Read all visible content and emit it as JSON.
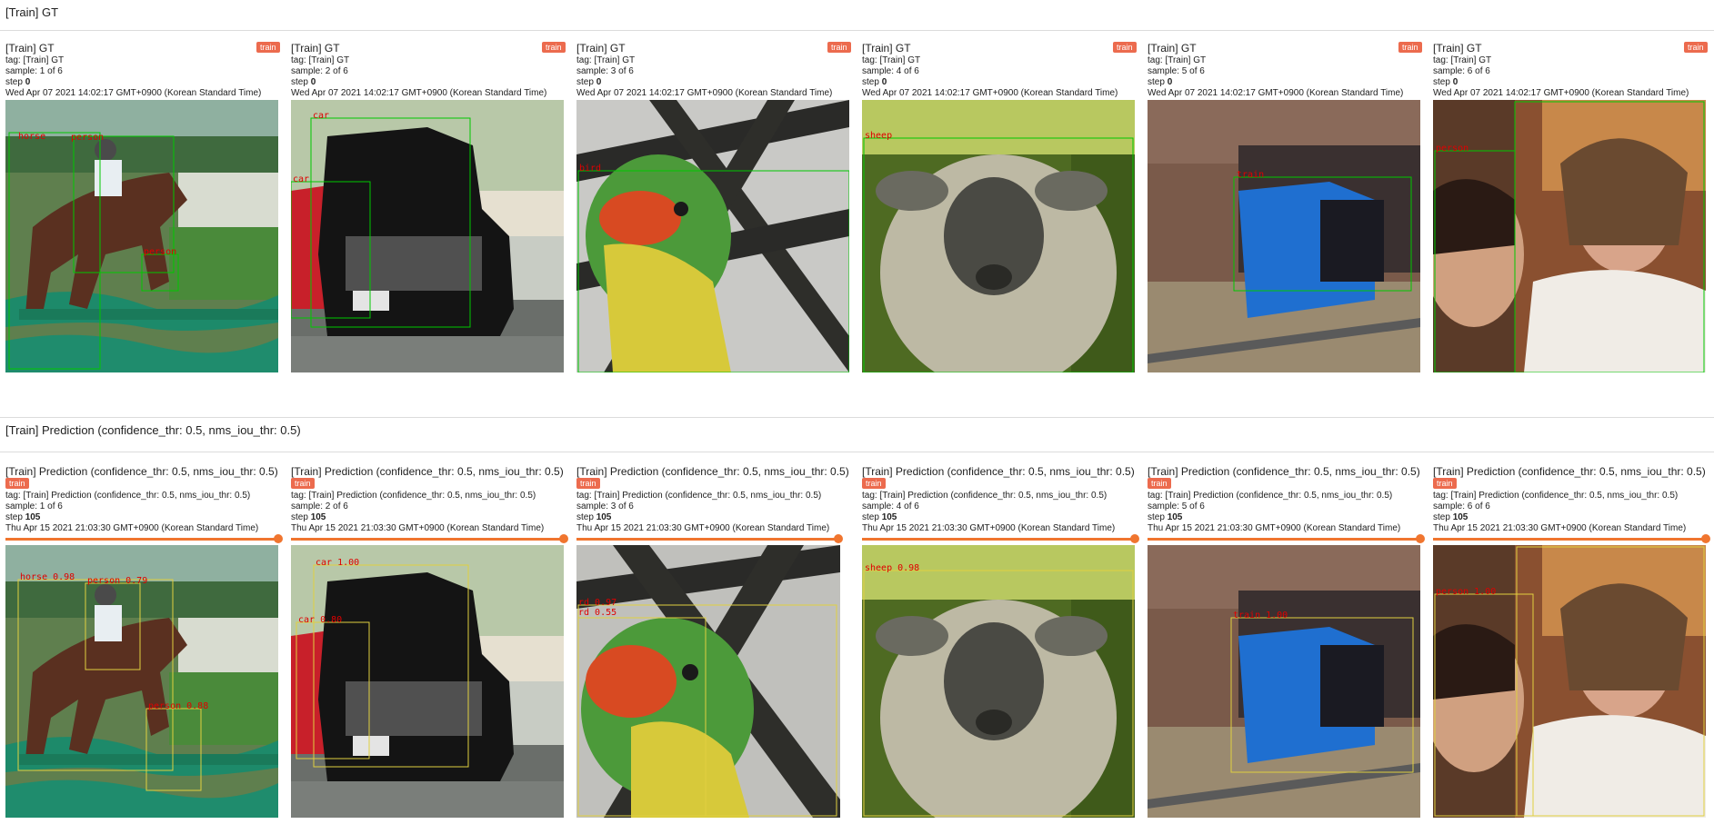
{
  "sections": {
    "gt": {
      "title": "[Train] GT",
      "cards": [
        {
          "title": "[Train] GT",
          "badge": "train",
          "tag": "tag: [Train] GT",
          "sample": "sample: 1 of 6",
          "step_label": "step ",
          "step": "0",
          "timestamp": "Wed Apr 07 2021 14:02:17 GMT+0900 (Korean Standard Time)",
          "labels": [
            "horse",
            "person",
            "person"
          ]
        },
        {
          "title": "[Train] GT",
          "badge": "train",
          "tag": "tag: [Train] GT",
          "sample": "sample: 2 of 6",
          "step_label": "step ",
          "step": "0",
          "timestamp": "Wed Apr 07 2021 14:02:17 GMT+0900 (Korean Standard Time)",
          "labels": [
            "car",
            "car"
          ]
        },
        {
          "title": "[Train] GT",
          "badge": "train",
          "tag": "tag: [Train] GT",
          "sample": "sample: 3 of 6",
          "step_label": "step ",
          "step": "0",
          "timestamp": "Wed Apr 07 2021 14:02:17 GMT+0900 (Korean Standard Time)",
          "labels": [
            "bird"
          ]
        },
        {
          "title": "[Train] GT",
          "badge": "train",
          "tag": "tag: [Train] GT",
          "sample": "sample: 4 of 6",
          "step_label": "step ",
          "step": "0",
          "timestamp": "Wed Apr 07 2021 14:02:17 GMT+0900 (Korean Standard Time)",
          "labels": [
            "sheep"
          ]
        },
        {
          "title": "[Train] GT",
          "badge": "train",
          "tag": "tag: [Train] GT",
          "sample": "sample: 5 of 6",
          "step_label": "step ",
          "step": "0",
          "timestamp": "Wed Apr 07 2021 14:02:17 GMT+0900 (Korean Standard Time)",
          "labels": [
            "train"
          ]
        },
        {
          "title": "[Train] GT",
          "badge": "train",
          "tag": "tag: [Train] GT",
          "sample": "sample: 6 of 6",
          "step_label": "step ",
          "step": "0",
          "timestamp": "Wed Apr 07 2021 14:02:17 GMT+0900 (Korean Standard Time)",
          "labels": [
            "person"
          ]
        }
      ]
    },
    "pred": {
      "title": "[Train] Prediction (confidence_thr: 0.5, nms_iou_thr: 0.5)",
      "cards": [
        {
          "title": "[Train] Prediction (confidence_thr: 0.5, nms_iou_thr: 0.5)",
          "badge": "train",
          "tag": "tag: [Train] Prediction (confidence_thr: 0.5, nms_iou_thr: 0.5)",
          "sample": "sample: 1 of 6",
          "step_label": "step ",
          "step": "105",
          "timestamp": "Thu Apr 15 2021 21:03:30 GMT+0900 (Korean Standard Time)",
          "slider": 1.0,
          "labels": [
            "horse 0.98",
            "person 0.79",
            "person 0.88"
          ]
        },
        {
          "title": "[Train] Prediction (confidence_thr: 0.5, nms_iou_thr: 0.5)",
          "badge": "train",
          "tag": "tag: [Train] Prediction (confidence_thr: 0.5, nms_iou_thr: 0.5)",
          "sample": "sample: 2 of 6",
          "step_label": "step ",
          "step": "105",
          "timestamp": "Thu Apr 15 2021 21:03:30 GMT+0900 (Korean Standard Time)",
          "slider": 1.0,
          "labels": [
            "car 1.00",
            "car 0.80"
          ]
        },
        {
          "title": "[Train] Prediction (confidence_thr: 0.5, nms_iou_thr: 0.5)",
          "badge": "train",
          "tag": "tag: [Train] Prediction (confidence_thr: 0.5, nms_iou_thr: 0.5)",
          "sample": "sample: 3 of 6",
          "step_label": "step ",
          "step": "105",
          "timestamp": "Thu Apr 15 2021 21:03:30 GMT+0900 (Korean Standard Time)",
          "slider": 1.0,
          "labels": [
            "rd 0.97",
            "rd 0.55"
          ]
        },
        {
          "title": "[Train] Prediction (confidence_thr: 0.5, nms_iou_thr: 0.5)",
          "badge": "train",
          "tag": "tag: [Train] Prediction (confidence_thr: 0.5, nms_iou_thr: 0.5)",
          "sample": "sample: 4 of 6",
          "step_label": "step ",
          "step": "105",
          "timestamp": "Thu Apr 15 2021 21:03:30 GMT+0900 (Korean Standard Time)",
          "slider": 1.0,
          "labels": [
            "sheep 0.98"
          ]
        },
        {
          "title": "[Train] Prediction (confidence_thr: 0.5, nms_iou_thr: 0.5)",
          "badge": "train",
          "tag": "tag: [Train] Prediction (confidence_thr: 0.5, nms_iou_thr: 0.5)",
          "sample": "sample: 5 of 6",
          "step_label": "step ",
          "step": "105",
          "timestamp": "Thu Apr 15 2021 21:03:30 GMT+0900 (Korean Standard Time)",
          "slider": 1.0,
          "labels": [
            "train 1.00"
          ]
        },
        {
          "title": "[Train] Prediction (confidence_thr: 0.5, nms_iou_thr: 0.5)",
          "badge": "train",
          "tag": "tag: [Train] Prediction (confidence_thr: 0.5, nms_iou_thr: 0.5)",
          "sample": "sample: 6 of 6",
          "step_label": "step ",
          "step": "105",
          "timestamp": "Thu Apr 15 2021 21:03:30 GMT+0900 (Korean Standard Time)",
          "slider": 1.0,
          "labels": [
            "person 1.00"
          ]
        }
      ]
    }
  },
  "colors": {
    "badge": "#ec6b4e",
    "slider": "#f0752f",
    "gt_box": "#00c800",
    "pred_box": "#e0d040",
    "label_text": "#e00000"
  }
}
